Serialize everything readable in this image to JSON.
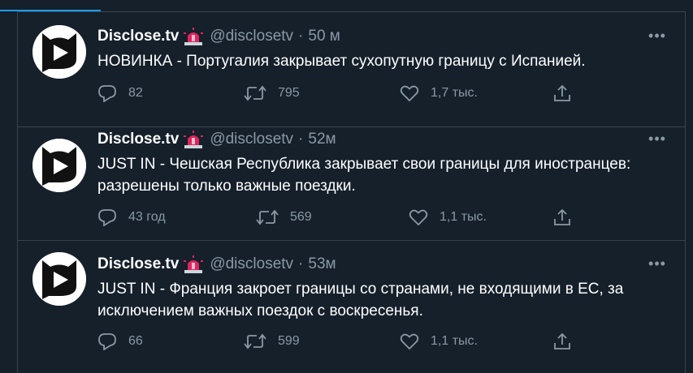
{
  "colors": {
    "background": "#15202b",
    "text": "#ffffff",
    "secondary_text": "#8b98a5",
    "divider": "#38444d",
    "accent": "#1d9bf0",
    "badge_red": "#e0245e"
  },
  "icons": {
    "reply": "reply-icon",
    "retweet": "retweet-icon",
    "like": "heart-icon",
    "share": "share-icon",
    "more": "more-icon",
    "badge": "siren-emoji-icon"
  },
  "tweets": [
    {
      "name": "Disclose.tv",
      "handle": "@disclosetv",
      "separator": "·",
      "time": "50 м",
      "text": "НОВИНКА - Португалия закрывает сухопутную границу с Испанией.",
      "replies": "82",
      "retweets": "795",
      "likes": "1,7 тыс.",
      "more": "•••"
    },
    {
      "name": "Disclose.tv",
      "handle": "@disclosetv",
      "separator": "·",
      "time": "52м",
      "text": "JUST IN - Чешская Республика закрывает свои границы для иностранцев: разрешены только важные поездки.",
      "replies": "43 год",
      "retweets": "569",
      "likes": "1,1 тыс.",
      "more": "•••"
    },
    {
      "name": "Disclose.tv",
      "handle": "@disclosetv",
      "separator": "·",
      "time": "53м",
      "text": "JUST IN - Франция закроет границы со странами, не входящими в ЕС, за исключением важных поездок с воскресенья.",
      "replies": "66",
      "retweets": "599",
      "likes": "1,1 тыс.",
      "more": "•••"
    }
  ]
}
